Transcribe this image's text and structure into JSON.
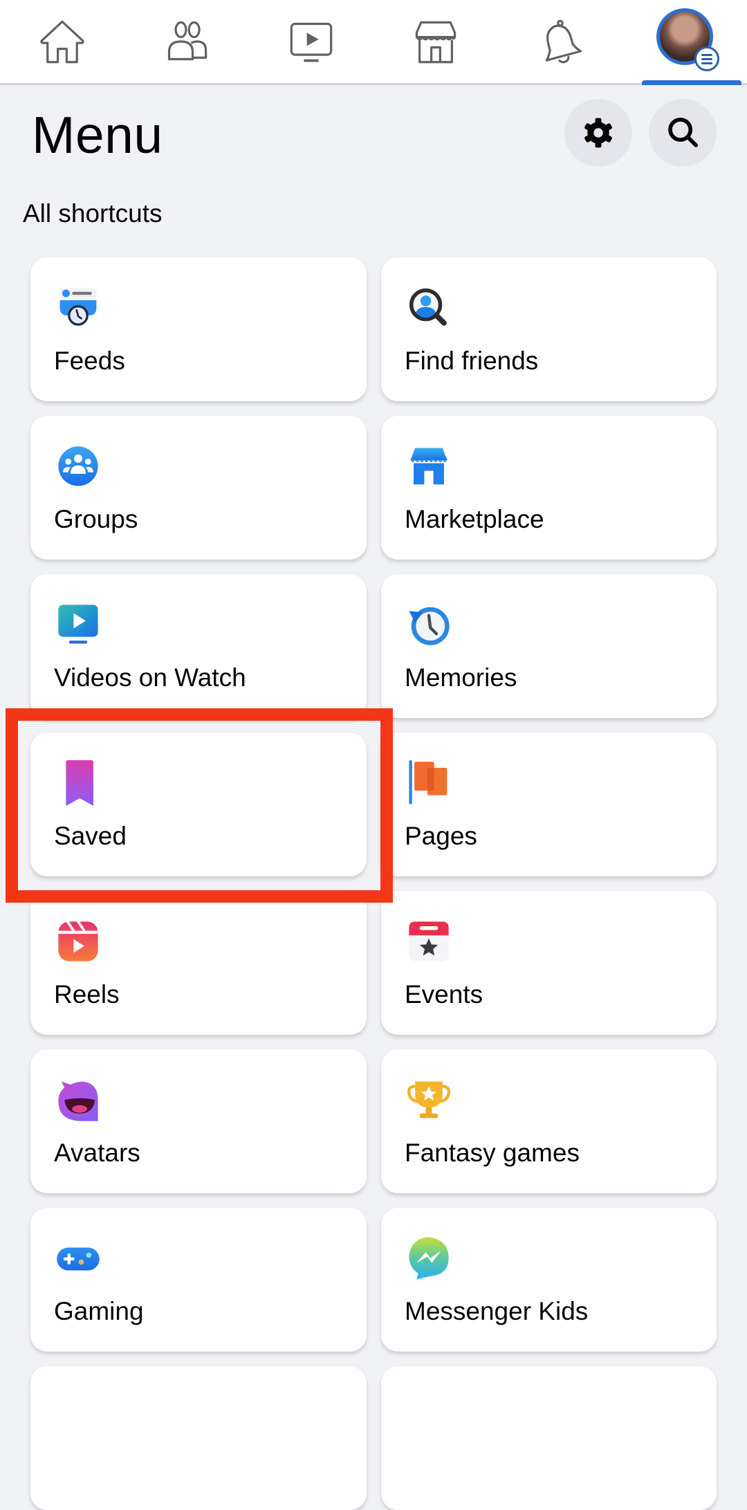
{
  "nav": {
    "tabs": [
      {
        "name": "home",
        "icon": "home-icon",
        "active": false
      },
      {
        "name": "friends",
        "icon": "friends-icon",
        "active": false
      },
      {
        "name": "watch",
        "icon": "video-icon",
        "active": false
      },
      {
        "name": "marketplace",
        "icon": "marketplace-icon",
        "active": false
      },
      {
        "name": "notifications",
        "icon": "bell-icon",
        "active": false
      },
      {
        "name": "menu",
        "icon": "profile-avatar-menu-icon",
        "active": true
      }
    ],
    "accent_color": "#2d6fd4"
  },
  "header": {
    "title": "Menu",
    "settings_icon": "gear-icon",
    "search_icon": "search-icon"
  },
  "section": {
    "label": "All shortcuts"
  },
  "shortcuts": [
    {
      "label": "Feeds",
      "icon": "feeds-icon"
    },
    {
      "label": "Find friends",
      "icon": "find-friends-icon"
    },
    {
      "label": "Groups",
      "icon": "groups-icon"
    },
    {
      "label": "Marketplace",
      "icon": "marketplace-store-icon"
    },
    {
      "label": "Videos on Watch",
      "icon": "watch-video-icon"
    },
    {
      "label": "Memories",
      "icon": "memories-clock-icon"
    },
    {
      "label": "Saved",
      "icon": "bookmark-icon",
      "highlighted": true
    },
    {
      "label": "Pages",
      "icon": "flag-icon"
    },
    {
      "label": "Reels",
      "icon": "reels-icon"
    },
    {
      "label": "Events",
      "icon": "calendar-star-icon"
    },
    {
      "label": "Avatars",
      "icon": "avatar-face-icon"
    },
    {
      "label": "Fantasy games",
      "icon": "trophy-icon"
    },
    {
      "label": "Gaming",
      "icon": "game-controller-icon"
    },
    {
      "label": "Messenger Kids",
      "icon": "messenger-kids-icon"
    }
  ],
  "highlight_color": "#f33616"
}
